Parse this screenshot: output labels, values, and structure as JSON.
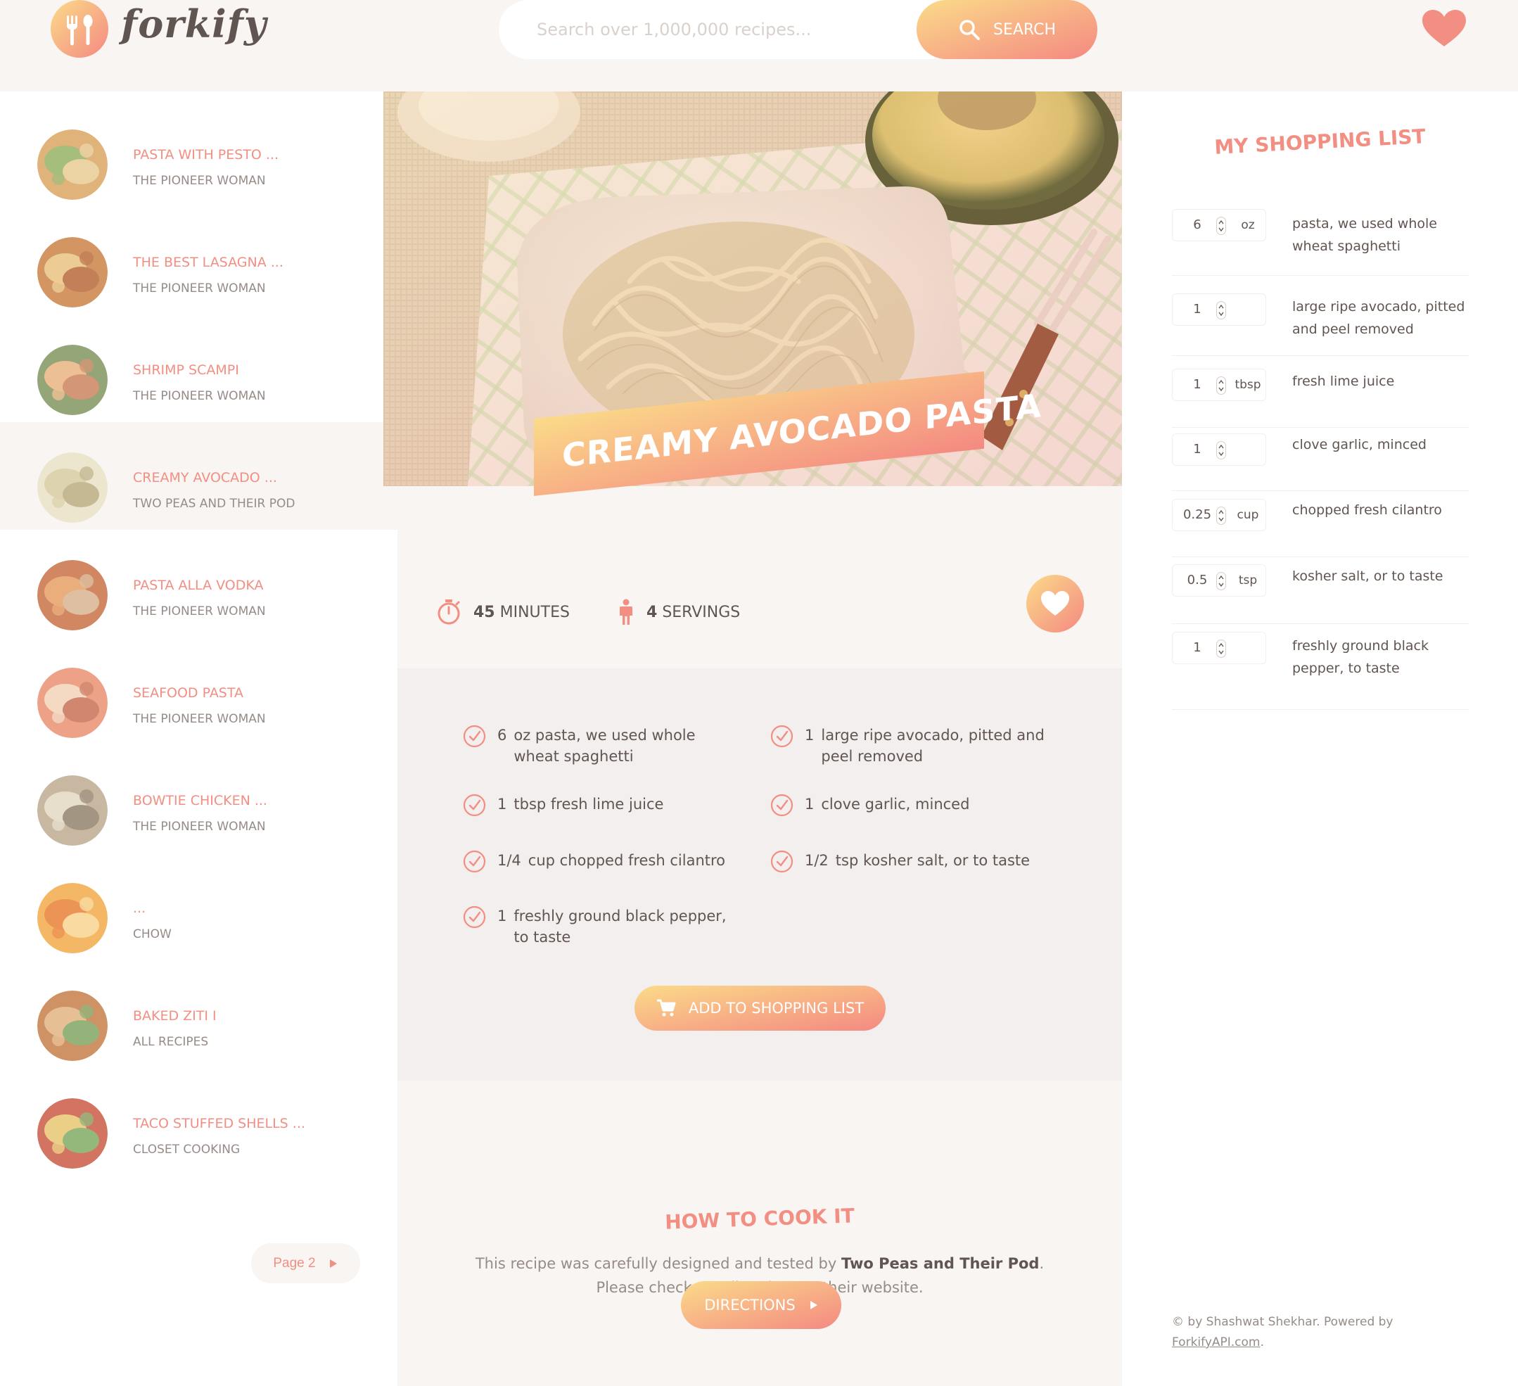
{
  "app": {
    "logo_text": "forkify"
  },
  "search": {
    "placeholder": "Search over 1,000,000 recipes...",
    "button_label": "SEARCH"
  },
  "results": [
    {
      "title": "PASTA WITH PESTO ...",
      "author": "THE PIONEER WOMAN",
      "active": false
    },
    {
      "title": "THE BEST LASAGNA ...",
      "author": "THE PIONEER WOMAN",
      "active": false
    },
    {
      "title": "SHRIMP SCAMPI",
      "author": "THE PIONEER WOMAN",
      "active": false
    },
    {
      "title": "CREAMY AVOCADO ...",
      "author": "TWO PEAS AND THEIR POD",
      "active": true
    },
    {
      "title": "PASTA ALLA VODKA",
      "author": "THE PIONEER WOMAN",
      "active": false
    },
    {
      "title": "SEAFOOD PASTA",
      "author": "THE PIONEER WOMAN",
      "active": false
    },
    {
      "title": "BOWTIE CHICKEN ...",
      "author": "THE PIONEER WOMAN",
      "active": false
    },
    {
      "title": "...",
      "author": "CHOW",
      "active": false
    },
    {
      "title": "BAKED ZITI I",
      "author": "ALL RECIPES",
      "active": false
    },
    {
      "title": "TACO STUFFED SHELLS ...",
      "author": "CLOSET COOKING",
      "active": false
    }
  ],
  "pagination": {
    "label": "Page 2"
  },
  "recipe": {
    "title": "CREAMY AVOCADO PASTA",
    "time_value": "45",
    "time_unit": "MINUTES",
    "servings_value": "4",
    "servings_unit": "SERVINGS",
    "ingredients": [
      {
        "qty": "6",
        "desc": "oz pasta, we used whole wheat spaghetti"
      },
      {
        "qty": "1",
        "desc": "large ripe avocado, pitted and peel removed"
      },
      {
        "qty": "1",
        "desc": "tbsp fresh lime juice"
      },
      {
        "qty": "1",
        "desc": "clove garlic, minced"
      },
      {
        "qty": "1/4",
        "desc": "cup chopped fresh cilantro"
      },
      {
        "qty": "1/2",
        "desc": "tsp kosher salt, or to taste"
      },
      {
        "qty": "1",
        "desc": "freshly ground black pepper, to taste"
      }
    ],
    "add_button_label": "ADD TO SHOPPING LIST",
    "cook_heading": "HOW TO COOK IT",
    "cook_text_before": "This recipe was carefully designed and tested by ",
    "cook_publisher": "Two Peas and Their Pod",
    "cook_text_after": ". Please check out directions at their website.",
    "directions_label": "DIRECTIONS"
  },
  "shopping": {
    "heading": "MY SHOPPING LIST",
    "items": [
      {
        "count": "6",
        "unit": "oz",
        "desc": "pasta, we used whole wheat spaghetti"
      },
      {
        "count": "1",
        "unit": "",
        "desc": "large ripe avocado, pitted and peel removed"
      },
      {
        "count": "1",
        "unit": "tbsp",
        "desc": "fresh lime juice"
      },
      {
        "count": "1",
        "unit": "",
        "desc": "clove garlic, minced"
      },
      {
        "count": "0.25",
        "unit": "cup",
        "desc": "chopped fresh cilantro"
      },
      {
        "count": "0.5",
        "unit": "tsp",
        "desc": "kosher salt, or to taste"
      },
      {
        "count": "1",
        "unit": "",
        "desc": "freshly ground black pepper, to taste"
      }
    ]
  },
  "footer": {
    "copyright_text": "© by Shashwat Shekhar. Powered by ",
    "link_text": "ForkifyAPI.com",
    "trailing": "."
  },
  "colors": {
    "primary": "#f38e82",
    "grad_start": "#fbdb89",
    "grad_end": "#f48982",
    "text": "#615551",
    "muted": "#968b87",
    "bg": "#f9f5f3"
  }
}
